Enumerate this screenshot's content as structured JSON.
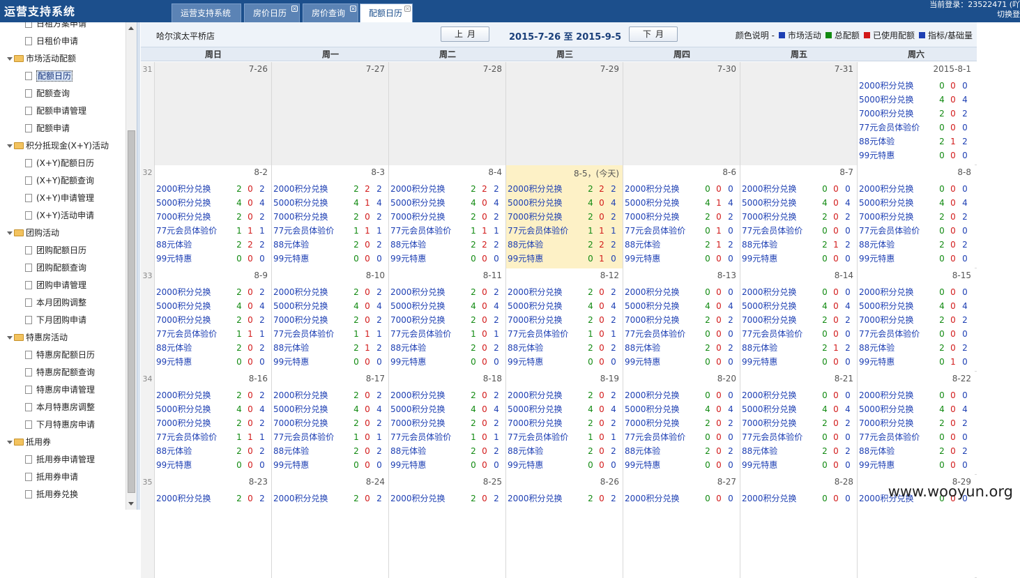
{
  "app": {
    "title": "运营支持系统",
    "login": "当前登录：23522471 (吖",
    "switch_label": "切换登"
  },
  "tabs": [
    {
      "label": "运营支持系统",
      "active": false,
      "closable": false
    },
    {
      "label": "房价日历",
      "active": false,
      "closable": true
    },
    {
      "label": "房价查询",
      "active": false,
      "closable": true
    },
    {
      "label": "配额日历",
      "active": true,
      "closable": true
    }
  ],
  "sidebar": {
    "top_items": [
      "日租方案申请",
      "日租价申请"
    ],
    "groups": [
      {
        "label": "市场活动配额",
        "items": [
          "配额日历",
          "配额查询",
          "配额申请管理",
          "配额申请"
        ]
      },
      {
        "label": "积分抵现金(X+Y)活动",
        "items": [
          "(X+Y)配额日历",
          "(X+Y)配额查询",
          "(X+Y)申请管理",
          "(X+Y)活动申请"
        ]
      },
      {
        "label": "团购活动",
        "items": [
          "团购配额日历",
          "团购配额查询",
          "团购申请管理",
          "本月团购调整",
          "下月团购申请"
        ]
      },
      {
        "label": "特惠房活动",
        "items": [
          "特惠房配额日历",
          "特惠房配额查询",
          "特惠房申请管理",
          "本月特惠房调整",
          "下月特惠房申请"
        ]
      },
      {
        "label": "抵用券",
        "items": [
          "抵用券申请管理",
          "抵用券申请",
          "抵用券兑换"
        ]
      }
    ],
    "active_item": "配额日历"
  },
  "header": {
    "store": "哈尔滨太平桥店",
    "prev_label": "上月",
    "next_label": "下月",
    "date_range": "2015-7-26 至 2015-9-5",
    "legend_prefix": "颜色说明 -",
    "legend": [
      {
        "label": "市场活动",
        "color": "#1d3fb3"
      },
      {
        "label": "总配额",
        "color": "#118a11"
      },
      {
        "label": "已使用配额",
        "color": "#d21919"
      },
      {
        "label": "指标/基础量",
        "color": "#1d3fb3"
      }
    ]
  },
  "weekdays": [
    "周日",
    "周一",
    "周二",
    "周三",
    "周四",
    "周五",
    "周六"
  ],
  "quota_names": [
    "2000积分兑换",
    "5000积分兑换",
    "7000积分兑换",
    "77元会员体验价",
    "88元体验",
    "99元特惠"
  ],
  "weeks": [
    {
      "num": "31",
      "days": [
        {
          "date": "7-26",
          "empty": true
        },
        {
          "date": "7-27",
          "empty": true
        },
        {
          "date": "7-28",
          "empty": true
        },
        {
          "date": "7-29",
          "empty": true
        },
        {
          "date": "7-30",
          "empty": true
        },
        {
          "date": "7-31",
          "empty": true
        },
        {
          "date": "2015-8-1",
          "q": [
            [
              0,
              0,
              0
            ],
            [
              4,
              0,
              4
            ],
            [
              2,
              0,
              2
            ],
            [
              0,
              0,
              0
            ],
            [
              2,
              1,
              2
            ],
            [
              0,
              0,
              0
            ]
          ]
        }
      ]
    },
    {
      "num": "32",
      "days": [
        {
          "date": "8-2",
          "q": [
            [
              2,
              0,
              2
            ],
            [
              4,
              0,
              4
            ],
            [
              2,
              0,
              2
            ],
            [
              1,
              1,
              1
            ],
            [
              2,
              2,
              2
            ],
            [
              0,
              0,
              0
            ]
          ]
        },
        {
          "date": "8-3",
          "q": [
            [
              2,
              2,
              2
            ],
            [
              4,
              1,
              4
            ],
            [
              2,
              0,
              2
            ],
            [
              1,
              1,
              1
            ],
            [
              2,
              0,
              2
            ],
            [
              0,
              0,
              0
            ]
          ]
        },
        {
          "date": "8-4",
          "q": [
            [
              2,
              2,
              2
            ],
            [
              4,
              0,
              4
            ],
            [
              2,
              0,
              2
            ],
            [
              1,
              1,
              1
            ],
            [
              2,
              2,
              2
            ],
            [
              0,
              0,
              0
            ]
          ]
        },
        {
          "date": "8-5，(今天)",
          "today": true,
          "q": [
            [
              2,
              2,
              2
            ],
            [
              4,
              0,
              4
            ],
            [
              2,
              0,
              2
            ],
            [
              1,
              1,
              1
            ],
            [
              2,
              2,
              2
            ],
            [
              0,
              1,
              0
            ]
          ]
        },
        {
          "date": "8-6",
          "q": [
            [
              0,
              0,
              0
            ],
            [
              4,
              1,
              4
            ],
            [
              2,
              0,
              2
            ],
            [
              0,
              1,
              0
            ],
            [
              2,
              1,
              2
            ],
            [
              0,
              0,
              0
            ]
          ]
        },
        {
          "date": "8-7",
          "q": [
            [
              0,
              0,
              0
            ],
            [
              4,
              0,
              4
            ],
            [
              2,
              0,
              2
            ],
            [
              0,
              0,
              0
            ],
            [
              2,
              1,
              2
            ],
            [
              0,
              0,
              0
            ]
          ]
        },
        {
          "date": "8-8",
          "q": [
            [
              0,
              0,
              0
            ],
            [
              4,
              0,
              4
            ],
            [
              2,
              0,
              2
            ],
            [
              0,
              0,
              0
            ],
            [
              2,
              0,
              2
            ],
            [
              0,
              0,
              0
            ]
          ]
        }
      ]
    },
    {
      "num": "33",
      "days": [
        {
          "date": "8-9",
          "q": [
            [
              2,
              0,
              2
            ],
            [
              4,
              0,
              4
            ],
            [
              2,
              0,
              2
            ],
            [
              1,
              1,
              1
            ],
            [
              2,
              0,
              2
            ],
            [
              0,
              0,
              0
            ]
          ]
        },
        {
          "date": "8-10",
          "q": [
            [
              2,
              0,
              2
            ],
            [
              4,
              0,
              4
            ],
            [
              2,
              0,
              2
            ],
            [
              1,
              1,
              1
            ],
            [
              2,
              1,
              2
            ],
            [
              0,
              0,
              0
            ]
          ]
        },
        {
          "date": "8-11",
          "q": [
            [
              2,
              0,
              2
            ],
            [
              4,
              0,
              4
            ],
            [
              2,
              0,
              2
            ],
            [
              1,
              0,
              1
            ],
            [
              2,
              0,
              2
            ],
            [
              0,
              0,
              0
            ]
          ]
        },
        {
          "date": "8-12",
          "q": [
            [
              2,
              0,
              2
            ],
            [
              4,
              0,
              4
            ],
            [
              2,
              0,
              2
            ],
            [
              1,
              0,
              1
            ],
            [
              2,
              0,
              2
            ],
            [
              0,
              0,
              0
            ]
          ]
        },
        {
          "date": "8-13",
          "q": [
            [
              0,
              0,
              0
            ],
            [
              4,
              0,
              4
            ],
            [
              2,
              0,
              2
            ],
            [
              0,
              0,
              0
            ],
            [
              2,
              0,
              2
            ],
            [
              0,
              0,
              0
            ]
          ]
        },
        {
          "date": "8-14",
          "q": [
            [
              0,
              0,
              0
            ],
            [
              4,
              0,
              4
            ],
            [
              2,
              0,
              2
            ],
            [
              0,
              0,
              0
            ],
            [
              2,
              1,
              2
            ],
            [
              0,
              0,
              0
            ]
          ]
        },
        {
          "date": "8-15",
          "q": [
            [
              0,
              0,
              0
            ],
            [
              4,
              0,
              4
            ],
            [
              2,
              0,
              2
            ],
            [
              0,
              0,
              0
            ],
            [
              2,
              0,
              2
            ],
            [
              0,
              1,
              0
            ]
          ]
        }
      ]
    },
    {
      "num": "34",
      "days": [
        {
          "date": "8-16",
          "q": [
            [
              2,
              0,
              2
            ],
            [
              4,
              0,
              4
            ],
            [
              2,
              0,
              2
            ],
            [
              1,
              1,
              1
            ],
            [
              2,
              0,
              2
            ],
            [
              0,
              0,
              0
            ]
          ]
        },
        {
          "date": "8-17",
          "q": [
            [
              2,
              0,
              2
            ],
            [
              4,
              0,
              4
            ],
            [
              2,
              0,
              2
            ],
            [
              1,
              0,
              1
            ],
            [
              2,
              0,
              2
            ],
            [
              0,
              0,
              0
            ]
          ]
        },
        {
          "date": "8-18",
          "q": [
            [
              2,
              0,
              2
            ],
            [
              4,
              0,
              4
            ],
            [
              2,
              0,
              2
            ],
            [
              1,
              0,
              1
            ],
            [
              2,
              0,
              2
            ],
            [
              0,
              0,
              0
            ]
          ]
        },
        {
          "date": "8-19",
          "q": [
            [
              2,
              0,
              2
            ],
            [
              4,
              0,
              4
            ],
            [
              2,
              0,
              2
            ],
            [
              1,
              0,
              1
            ],
            [
              2,
              0,
              2
            ],
            [
              0,
              0,
              0
            ]
          ]
        },
        {
          "date": "8-20",
          "q": [
            [
              0,
              0,
              0
            ],
            [
              4,
              0,
              4
            ],
            [
              2,
              0,
              2
            ],
            [
              0,
              0,
              0
            ],
            [
              2,
              0,
              2
            ],
            [
              0,
              0,
              0
            ]
          ]
        },
        {
          "date": "8-21",
          "q": [
            [
              0,
              0,
              0
            ],
            [
              4,
              0,
              4
            ],
            [
              2,
              0,
              2
            ],
            [
              0,
              0,
              0
            ],
            [
              2,
              0,
              2
            ],
            [
              0,
              0,
              0
            ]
          ]
        },
        {
          "date": "8-22",
          "q": [
            [
              0,
              0,
              0
            ],
            [
              4,
              0,
              4
            ],
            [
              2,
              0,
              2
            ],
            [
              0,
              0,
              0
            ],
            [
              2,
              0,
              2
            ],
            [
              0,
              0,
              0
            ]
          ]
        }
      ]
    },
    {
      "num": "35",
      "days": [
        {
          "date": "8-23",
          "q": [
            [
              2,
              0,
              2
            ]
          ]
        },
        {
          "date": "8-24",
          "q": [
            [
              2,
              0,
              2
            ]
          ]
        },
        {
          "date": "8-25",
          "q": [
            [
              2,
              0,
              2
            ]
          ]
        },
        {
          "date": "8-26",
          "q": [
            [
              2,
              0,
              2
            ]
          ]
        },
        {
          "date": "8-27",
          "q": [
            [
              0,
              0,
              0
            ]
          ]
        },
        {
          "date": "8-28",
          "q": [
            [
              0,
              0,
              0
            ]
          ]
        },
        {
          "date": "8-29",
          "q": [
            [
              0,
              0,
              0
            ]
          ]
        }
      ]
    }
  ],
  "watermark": "www.wooyun.org"
}
